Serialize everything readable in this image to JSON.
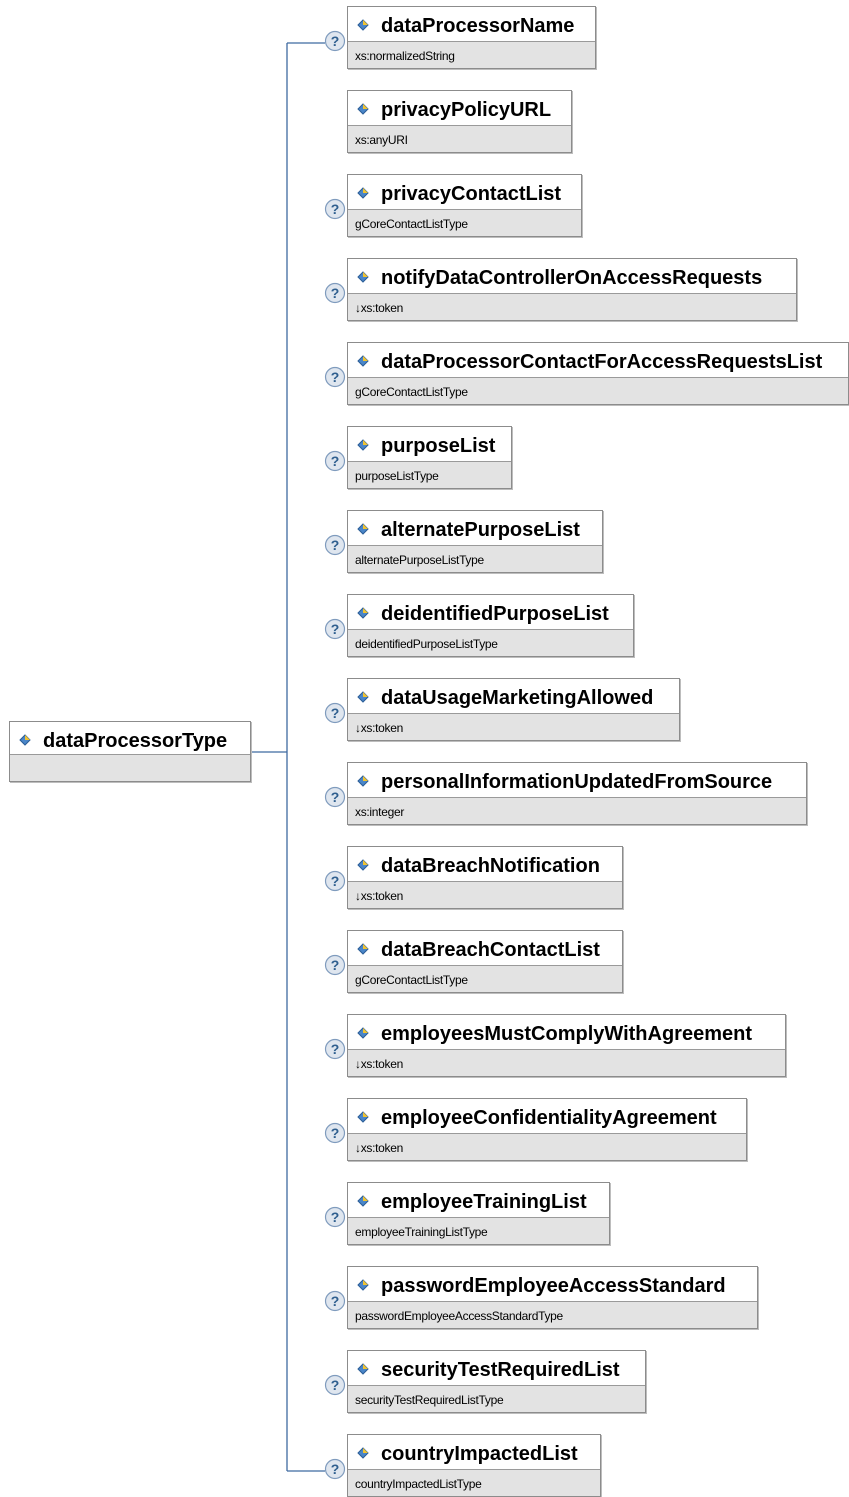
{
  "root": {
    "name": "dataProcessorType",
    "type": ""
  },
  "elements": [
    {
      "name": "dataProcessorName",
      "type": "xs:normalizedString",
      "help": true
    },
    {
      "name": "privacyPolicyURL",
      "type": "xs:anyURI",
      "help": false
    },
    {
      "name": "privacyContactList",
      "type": "gCoreContactListType",
      "help": true
    },
    {
      "name": "notifyDataControllerOnAccessRequests",
      "type": "↓xs:token",
      "help": true
    },
    {
      "name": "dataProcessorContactForAccessRequestsList",
      "type": "gCoreContactListType",
      "help": true
    },
    {
      "name": "purposeList",
      "type": "purposeListType",
      "help": true
    },
    {
      "name": "alternatePurposeList",
      "type": "alternatePurposeListType",
      "help": true
    },
    {
      "name": "deidentifiedPurposeList",
      "type": "deidentifiedPurposeListType",
      "help": true
    },
    {
      "name": "dataUsageMarketingAllowed",
      "type": "↓xs:token",
      "help": true
    },
    {
      "name": "personalInformationUpdatedFromSource",
      "type": "xs:integer",
      "help": true
    },
    {
      "name": "dataBreachNotification",
      "type": "↓xs:token",
      "help": true
    },
    {
      "name": "dataBreachContactList",
      "type": "gCoreContactListType",
      "help": true
    },
    {
      "name": "employeesMustComplyWithAgreement",
      "type": "↓xs:token",
      "help": true
    },
    {
      "name": "employeeConfidentialityAgreement",
      "type": "↓xs:token",
      "help": true
    },
    {
      "name": "employeeTrainingList",
      "type": "employeeTrainingListType",
      "help": true
    },
    {
      "name": "passwordEmployeeAccessStandard",
      "type": "passwordEmployeeAccessStandardType",
      "help": true
    },
    {
      "name": "securityTestRequiredList",
      "type": "securityTestRequiredListType",
      "help": true
    },
    {
      "name": "countryImpactedList",
      "type": "countryImpactedListType",
      "help": true
    }
  ],
  "colors": {
    "connector": "#3f6aa0",
    "box_footer": "#e3e3e3",
    "help_fill": "#dfe6ef",
    "help_text": "#2f5f8f"
  },
  "icons": {
    "element": "element-diamond-icon",
    "help": "help-question-icon"
  }
}
